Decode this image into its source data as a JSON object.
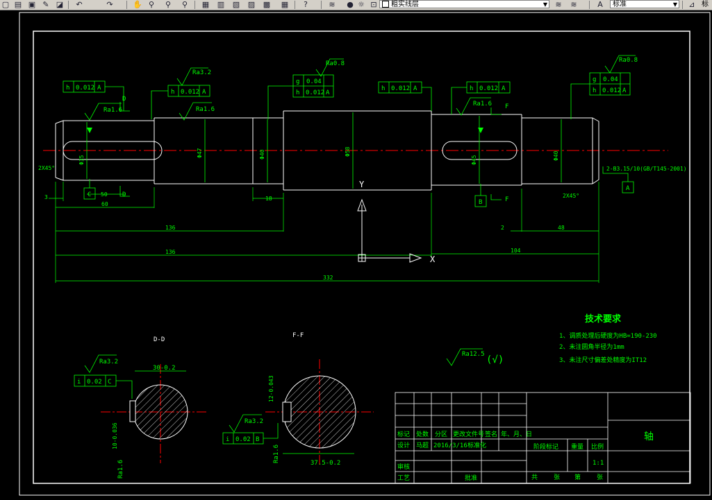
{
  "toolbar": {
    "layer_name": "粗实线层",
    "text_style": "标准",
    "right_fragment": "标"
  },
  "drawing": {
    "colors": {
      "background": "#000000",
      "outline": "#ffffff",
      "dimension": "#00ff00",
      "centerline": "#ff0000",
      "hatch": "#ffffff"
    },
    "views": {
      "section_d": "D-D",
      "section_f": "F-F"
    },
    "callouts": {
      "h1": "h",
      "h1v": "0.012",
      "h1d": "A",
      "h2": "h",
      "h2v": "0.012",
      "h2d": "A",
      "g3": "g",
      "g3v": "0.04",
      "h3": "h",
      "h3v": "0.012",
      "h3d": "A",
      "h4": "h",
      "h4v": "0.012",
      "h4d": "A",
      "h5": "h",
      "h5v": "0.012",
      "h5d": "A",
      "g6": "g",
      "g6v": "0.04",
      "h6": "h",
      "h6v": "0.012",
      "h6d": "A",
      "i1": "i",
      "i1v": "0.02",
      "i1d": "C",
      "i2": "i",
      "i2v": "0.02",
      "i2d": "B"
    },
    "roughness": {
      "r1": "Ra3.2",
      "r2": "Ra1.6",
      "r3": "Ra0.8",
      "r4": "Ra1.6",
      "r5": "Ra0.8",
      "r6": "Ra1.6",
      "r7": "Ra3.2",
      "r8": "Ra3.2",
      "r9": "Ra1.6",
      "r10": "Ra1.6",
      "general": "Ra12.5",
      "general_sym": "(√)"
    },
    "labels": {
      "D1": "D",
      "D2": "D",
      "F1": "F",
      "F2": "F",
      "C": "C",
      "B": "B",
      "A": "A",
      "chamfer_left": "2X45°",
      "chamfer_right": "2X45°",
      "center_holes": "2-B3.15/10(GB/T145-2001)"
    },
    "dims": {
      "d1": "60",
      "d2": "136",
      "d3": "136",
      "d4": "332",
      "d5": "18",
      "d6": "50",
      "d7": "104",
      "d8": "48",
      "d9": "2",
      "d10": "2",
      "d11": "3",
      "dia1": "Φ35",
      "dia2": "Φ47",
      "dia3": "Φ40",
      "dia4": "Φ58",
      "dia5": "Φ45",
      "dia6": "Φ40",
      "sec_d_top": "30-0.2",
      "sec_d_side": "10-0.036",
      "sec_f_top": "12-0.043",
      "sec_f_bot": "37.5-0.2"
    },
    "ucs": {
      "y": "Y",
      "x": "X"
    },
    "tech": {
      "title": "技术要求",
      "line1": "1、调质处理后硬度为HB=190-230",
      "line2": "2、未注圆角半径为1mm",
      "line3": "3、未注尺寸偏差处精度为IT12"
    },
    "title_block": {
      "part_name": "轴",
      "mark": "标记",
      "count": "处数",
      "zone": "分区",
      "doc_no": "更改文件号",
      "sign": "签名",
      "date": "年、月、日",
      "design": "设计",
      "designer": "马超",
      "design_date": "2016/3/16",
      "standard": "标准化",
      "stage": "阶段标记",
      "weight": "重量",
      "scale_label": "比例",
      "scale": "1:1",
      "review": "审核",
      "process": "工艺",
      "approve": "批准",
      "total": "共",
      "sheets1": "张",
      "page": "第",
      "sheets2": "张"
    }
  }
}
